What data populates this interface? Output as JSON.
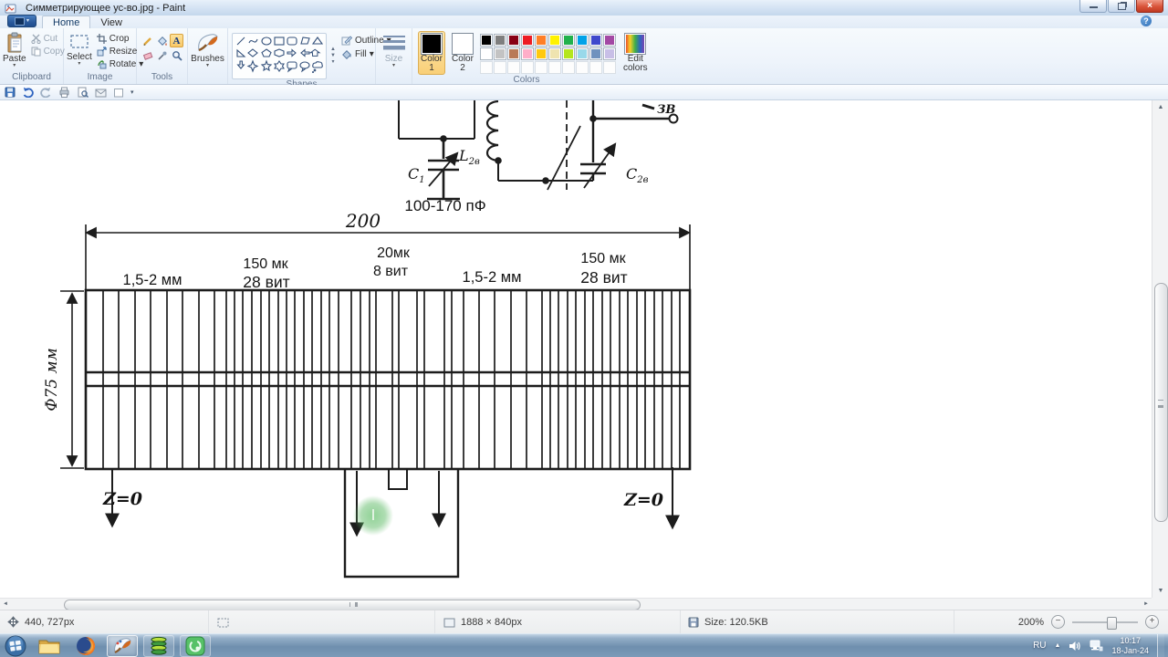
{
  "window": {
    "title": "Симметрирующее ус-во.jpg - Paint"
  },
  "tabs": {
    "home": "Home",
    "view": "View"
  },
  "icons": {
    "caret": "▾",
    "scroll_up": "▲",
    "scroll_down": "▼",
    "scroll_left": "◄",
    "scroll_right": "►",
    "tray_expand": "▲",
    "zoom_out": "−",
    "zoom_in": "+",
    "help": "?",
    "close": "×",
    "text_tool": "A"
  },
  "ribbon": {
    "clipboard": {
      "group": "Clipboard",
      "paste": "Paste",
      "cut": "Cut",
      "copy": "Copy"
    },
    "image": {
      "group": "Image",
      "select": "Select",
      "crop": "Crop",
      "resize": "Resize",
      "rotate": "Rotate"
    },
    "tools": {
      "group": "Tools"
    },
    "brushes": {
      "label": "Brushes"
    },
    "shapes": {
      "group": "Shapes",
      "outline": "Outline",
      "fill": "Fill"
    },
    "size": {
      "label": "Size"
    },
    "colors": {
      "group": "Colors",
      "color1_line1": "Color",
      "color1_line2": "1",
      "color2_line1": "Color",
      "color2_line2": "2",
      "edit_line1": "Edit",
      "edit_line2": "colors",
      "palette": [
        [
          "#000000",
          "#7f7f7f",
          "#880015",
          "#ed1c24",
          "#ff7f27",
          "#fff200",
          "#22b14c",
          "#00a2e8",
          "#3f48cc",
          "#a349a4"
        ],
        [
          "#ffffff",
          "#c3c3c3",
          "#b97a57",
          "#ffaec9",
          "#ffc90e",
          "#efe4b0",
          "#b5e61d",
          "#99d9ea",
          "#7092be",
          "#c8bfe7"
        ],
        [
          "",
          "",
          "",
          "",
          "",
          "",
          "",
          "",
          "",
          ""
        ]
      ]
    }
  },
  "canvas_diagram": {
    "dim_width": "200",
    "dim_diameter": "Ф75 мм",
    "cap_range": "100-170 пФ",
    "c1": {
      "main": "C",
      "sub": "1"
    },
    "l2": {
      "main": "L",
      "sub": "2в"
    },
    "c2": {
      "main": "C",
      "sub": "2в"
    },
    "terminal": "ЗВ",
    "z_left": "Z=0",
    "z_right": "Z=0",
    "windings": {
      "w1": "1,5-2 мм",
      "w2a": "150 мк",
      "w2b": "28 вит",
      "w3a": "20мк",
      "w3b": "8 вит",
      "w4": "1,5-2 мм",
      "w5a": "150 мк",
      "w5b": "28 вит"
    },
    "coil_line_xs": [
      113,
      130,
      148,
      165,
      183,
      200,
      218,
      235,
      248,
      257,
      266,
      276,
      286,
      295,
      305,
      314,
      323,
      333,
      342,
      352,
      361,
      371,
      385,
      395,
      405,
      412,
      430,
      437,
      457,
      465,
      487,
      495,
      508,
      525,
      542,
      560,
      577,
      594,
      603,
      612,
      622,
      631,
      641,
      650,
      660,
      669,
      679,
      688,
      698,
      707,
      717,
      726,
      736,
      745
    ],
    "highlight_color": "#58b55e"
  },
  "statusbar": {
    "cursor_pos": "440, 727px",
    "image_dims": "1888 × 840px",
    "file_size": "Size: 120.5KB",
    "zoom_level": "200%"
  },
  "taskbar": {
    "language": "RU",
    "time": "10:17",
    "date": "18-Jan-24"
  }
}
